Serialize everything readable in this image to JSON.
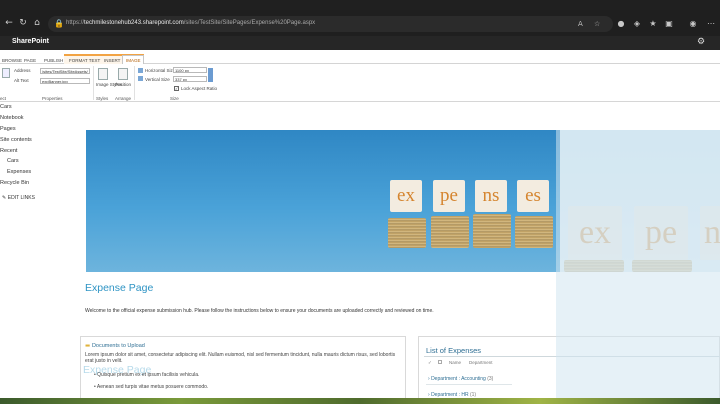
{
  "browser": {
    "url_prefix": "https://",
    "url_host": "techmilestonehub243.sharepoint.com",
    "url_path": "/sites/TestSite/SitePages/Expense%20Page.aspx"
  },
  "suite": {
    "title": "SharePoint"
  },
  "ribbon": {
    "tabs": [
      "BROWSE",
      "PAGE",
      "PUBLISH",
      "FORMAT TEXT",
      "INSERT",
      "IMAGE"
    ],
    "address_label": "Address",
    "address_value": "/sites/TestSite/SiteAssets/",
    "alt_text_label": "Alt Text",
    "alt_text_value": "expBanner.jpg",
    "image_styles_label": "Image Styles",
    "position_label": "Position",
    "horizontal_size_label": "Horizontal Size",
    "horizontal_size_value": "1100 px",
    "vertical_size_label": "Vertical Size",
    "vertical_size_value": "337 px",
    "lock_label": "Lock Aspect Ratio",
    "groups": {
      "properties": "Properties",
      "styles": "Styles",
      "arrange": "Arrange",
      "size": "Size",
      "select": "ect"
    }
  },
  "leftnav": {
    "items": [
      "Cars",
      "Notebook",
      "Pages",
      "Site contents",
      "Recent",
      "Cars",
      "Expenses",
      "Recycle Bin",
      "EDIT LINKS"
    ]
  },
  "hero": {
    "blocks": [
      "ex",
      "pe",
      "ns",
      "es"
    ],
    "blocks_large": [
      "ex",
      "pe",
      "n"
    ]
  },
  "page": {
    "title": "Expense Page",
    "welcome": "Welcome to the official expense submission hub. Please follow the instructions below to ensure your documents are uploaded correctly and reviewed on time."
  },
  "docs": {
    "title": "Documents to Upload",
    "lorem": "Lorem ipsum dolor sit amet, consectetur adipiscing elit. Nullam euismod, nisl sed fermentum tincidunt, nulla mauris dictum risus, sed lobortis erat justo in velit.",
    "ghost_title": "Expense Page",
    "bullets": [
      "Quisque pretium ex et ipsum facilisis vehicula.",
      "Aenean sed turpis vitae metus posuere commodo."
    ]
  },
  "expenses": {
    "title": "List of Expenses",
    "col_name": "Name",
    "col_department": "Department",
    "dept1_label": "Department : Accounting",
    "dept1_count": "(3)",
    "dept2_label": "Department : HR",
    "dept2_count": "(1)"
  }
}
